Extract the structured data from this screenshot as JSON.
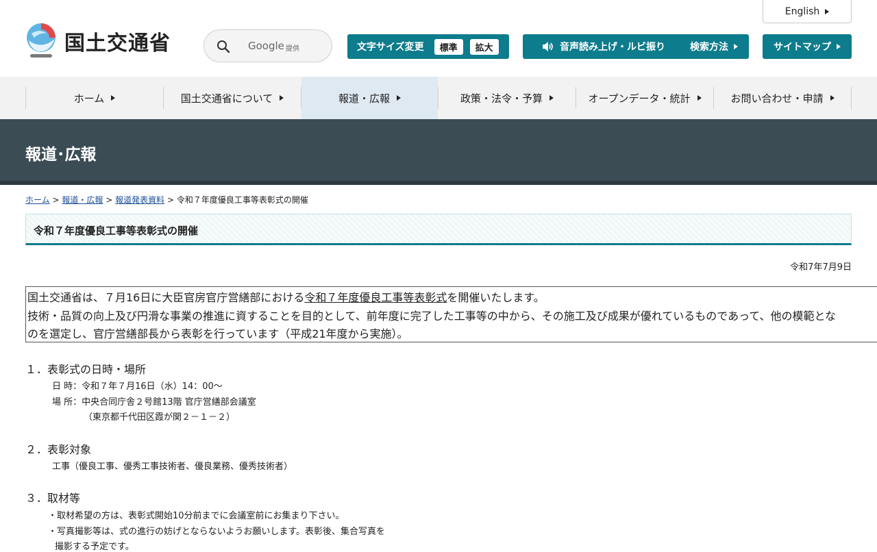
{
  "header": {
    "logo_text": "国土交通省",
    "search": {
      "google": "Google",
      "provided": "提供"
    },
    "font_size": {
      "label": "文字サイズ変更",
      "standard": "標準",
      "large": "拡大"
    },
    "voice_label": "音声読み上げ・ルビ振り",
    "search_method_label": "検索方法",
    "sitemap_label": "サイトマップ",
    "english_label": "English"
  },
  "nav": {
    "items": [
      {
        "label": "ホーム"
      },
      {
        "label": "国土交通省について"
      },
      {
        "label": "報道・広報"
      },
      {
        "label": "政策・法令・予算"
      },
      {
        "label": "オープンデータ・統計"
      },
      {
        "label": "お問い合わせ・申請"
      }
    ]
  },
  "banner": {
    "title": "報道･広報"
  },
  "breadcrumb": {
    "home": "ホーム",
    "press": "報道・広報",
    "releases": "報道発表資料",
    "current": "令和７年度優良工事等表彰式の開催",
    "sep": ">"
  },
  "page": {
    "title": "令和７年度優良工事等表彰式の開催",
    "date": "令和7年7月9日"
  },
  "intro": {
    "line1_before": "国土交通省は、７月16日に大臣官房官庁営繕部における",
    "line1_link": "令和７年度優良工事等表彰式",
    "line1_after": "を開催いたします。",
    "line2": "技術・品質の向上及び円滑な事業の推進に資することを目的として、前年度に完了した工事等の中から、その施工及び成果が優れているものであって、他の模範とな",
    "line3": "のを選定し、官庁営繕部長から表彰を行っています（平成21年度から実施）。"
  },
  "sections": {
    "s1": {
      "heading": "１．表彰式の日時・場所",
      "datetime": "日 時：令和７年７月16日（水）14：00～",
      "place": "場 所：中央合同庁舎２号館13階 官庁営繕部会議室",
      "address": "（東京都千代田区霞が関２－１－２）"
    },
    "s2": {
      "heading": "２．表彰対象",
      "text": "工事（優良工事、優秀工事技術者、優良業務、優秀技術者）"
    },
    "s3": {
      "heading": "３．取材等",
      "line1": "・取材希望の方は、表彰式開始10分前までに会議室前にお集まり下さい。",
      "line2": "・写真撮影等は、式の進行の妨げとならないようお願いします。表彰後、集合写真を",
      "line3": "撮影する予定です。"
    }
  },
  "colors": {
    "accent": "#0d7c8c",
    "banner": "#3b4c54",
    "nav_active": "#dfe9f1"
  }
}
